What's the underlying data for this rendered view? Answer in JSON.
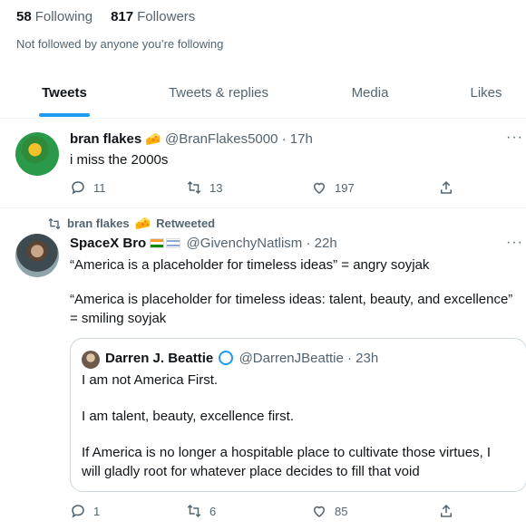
{
  "follow": {
    "following_count": "58",
    "following_label": "Following",
    "followers_count": "817",
    "followers_label": "Followers",
    "note": "Not followed by anyone you’re following"
  },
  "tabs": [
    {
      "label": "Tweets",
      "active": true
    },
    {
      "label": "Tweets & replies",
      "active": false
    },
    {
      "label": "Media",
      "active": false
    },
    {
      "label": "Likes",
      "active": false
    }
  ],
  "tweets": [
    {
      "name": "bran flakes",
      "emoji": "🧀",
      "handle": "@BranFlakes5000",
      "time": "· 17h",
      "text": "i miss the 2000s",
      "replies": "11",
      "retweets": "13",
      "likes": "197"
    },
    {
      "retweeted_by": "bran flakes",
      "retweeted_emoji": "🧀",
      "retweeted_label": "Retweeted",
      "name": "SpaceX Bro",
      "handle": "@GivenchyNatlism",
      "time": "· 22h",
      "text_lines": [
        "“America is a placeholder for timeless ideas” = angry soyjak",
        "“America is placeholder for timeless ideas: talent, beauty, and excellence”",
        "= smiling soyjak"
      ],
      "quote": {
        "name": "Darren J. Beattie",
        "handle": "@DarrenJBeattie",
        "time": "· 23h",
        "lines": [
          "I am not America First.",
          "I am talent, beauty, excellence first.",
          "If America is no longer a hospitable place to cultivate those virtues, I",
          "will gladly root for whatever place decides to fill that void"
        ]
      },
      "replies": "1",
      "retweets": "6",
      "likes": "85"
    }
  ],
  "colors": {
    "accent": "#1d9bf0",
    "text_primary": "#0f1419",
    "text_secondary": "#536471",
    "divider": "#eff3f4"
  }
}
